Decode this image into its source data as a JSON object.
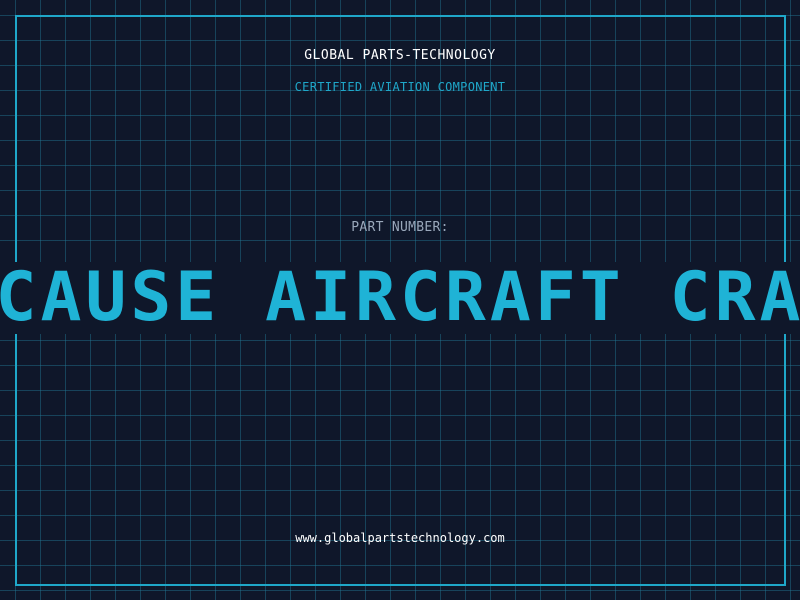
{
  "header": {
    "company": "GLOBAL PARTS-TECHNOLOGY",
    "subtitle": "CERTIFIED AVIATION COMPONENT"
  },
  "part": {
    "label": "PART NUMBER:",
    "value": "MAY CAUSE AIRCRAFT CRASHES"
  },
  "footer": {
    "url": "www.globalpartstechnology.com"
  },
  "colors": {
    "background": "#0f172a",
    "grid": "#22789a",
    "accent": "#1fb3d6",
    "text": "#ffffff",
    "muted": "#9aa8bb"
  }
}
